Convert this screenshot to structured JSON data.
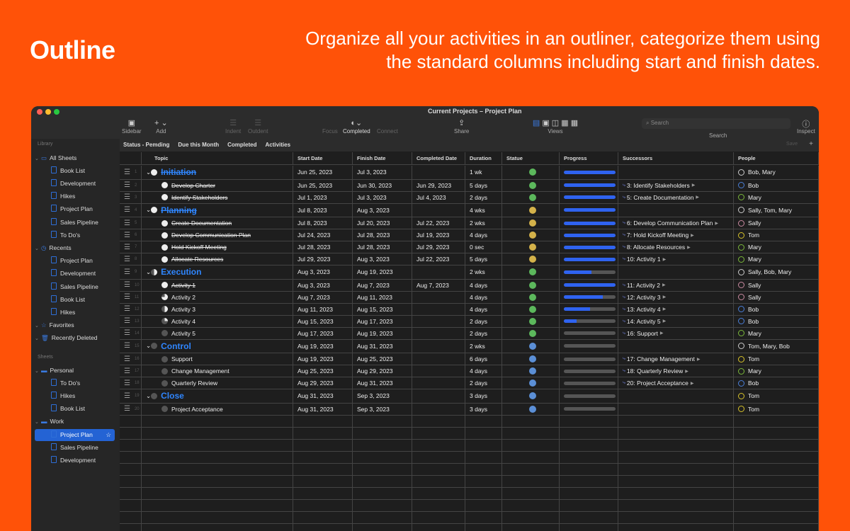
{
  "hero": {
    "title": "Outline",
    "text": "Organize all your activities in an outliner, categorize them using the standard columns including start and finish dates."
  },
  "window": {
    "title": "Current Projects – Project Plan"
  },
  "toolbar": {
    "sidebar": "Sidebar",
    "add": "Add",
    "indent": "Indent",
    "outdent": "Outdent",
    "focus": "Focus",
    "completed": "Completed",
    "connect": "Connect",
    "share": "Share",
    "views": "Views",
    "search_placeholder": "Search",
    "search": "Search",
    "inspect": "Inspect",
    "save": "Save"
  },
  "filters": [
    "Status - Pemding",
    "Due this Month",
    "Completed",
    "Activities"
  ],
  "sidebar": {
    "library": "Library",
    "sheets_label": "Sheets",
    "items": [
      {
        "label": "All Sheets",
        "type": "group",
        "icon": "tray-icon"
      },
      {
        "label": "Book List",
        "type": "child"
      },
      {
        "label": "Development",
        "type": "child"
      },
      {
        "label": "Hikes",
        "type": "child"
      },
      {
        "label": "Project Plan",
        "type": "child"
      },
      {
        "label": "Sales Pipeline",
        "type": "child"
      },
      {
        "label": "To Do's",
        "type": "child"
      },
      {
        "label": "Recents",
        "type": "group",
        "icon": "clock-icon"
      },
      {
        "label": "Project Plan",
        "type": "child"
      },
      {
        "label": "Development",
        "type": "child"
      },
      {
        "label": "Sales Pipeline",
        "type": "child"
      },
      {
        "label": "Book List",
        "type": "child"
      },
      {
        "label": "Hikes",
        "type": "child"
      },
      {
        "label": "Favorites",
        "type": "group",
        "icon": "star-icon"
      },
      {
        "label": "Recently Deleted",
        "type": "group",
        "icon": "trash-icon"
      }
    ],
    "sheets": [
      {
        "label": "Personal",
        "type": "group",
        "icon": "folder-icon"
      },
      {
        "label": "To Do's",
        "type": "child"
      },
      {
        "label": "Hikes",
        "type": "child"
      },
      {
        "label": "Book List",
        "type": "child"
      },
      {
        "label": "Work",
        "type": "group",
        "icon": "folder-icon"
      },
      {
        "label": "Project Plan",
        "type": "child",
        "selected": true
      },
      {
        "label": "Sales Pipeline",
        "type": "child"
      },
      {
        "label": "Development",
        "type": "child"
      }
    ]
  },
  "columns": [
    "Topic",
    "Start Date",
    "Finish Date",
    "Completed Date",
    "Duration",
    "Statue",
    "Progress",
    "Successors",
    "People"
  ],
  "status_colors": {
    "green": "#5cb85c",
    "yellow": "#d4b24a",
    "blue": "#5b8fd6"
  },
  "rows": [
    {
      "n": "1",
      "topic": "Initiation",
      "group": true,
      "done": true,
      "start": "Jun 25, 2023",
      "finish": "Jul 3, 2023",
      "completed": "",
      "duration": "1 wk",
      "status": "green",
      "progress": 100,
      "succ": "",
      "people": "Bob, Mary",
      "pc": "#ccc"
    },
    {
      "n": "2",
      "topic": "Develop Charter",
      "done": true,
      "start": "Jun 25, 2023",
      "finish": "Jun 30, 2023",
      "completed": "Jun 29, 2023",
      "duration": "5 days",
      "status": "green",
      "progress": 100,
      "succ": "3: Identify Stakeholders",
      "people": "Bob",
      "pc": "#4a7fd8"
    },
    {
      "n": "3",
      "topic": "Identify Stakeholders",
      "done": true,
      "start": "Jul 1, 2023",
      "finish": "Jul 3, 2023",
      "completed": "Jul 4, 2023",
      "duration": "2 days",
      "status": "green",
      "progress": 100,
      "succ": "5: Create Documentation",
      "people": "Mary",
      "pc": "#7ab83a"
    },
    {
      "n": "4",
      "topic": "Planning",
      "group": true,
      "done": true,
      "start": "Jul 8, 2023",
      "finish": "Aug 3, 2023",
      "completed": "",
      "duration": "4 wks",
      "status": "yellow",
      "progress": 100,
      "succ": "",
      "people": "Sally, Tom, Mary",
      "pc": "#ccc"
    },
    {
      "n": "5",
      "topic": "Create Documentation",
      "done": true,
      "start": "Jul 8, 2023",
      "finish": "Jul 20, 2023",
      "completed": "Jul 22, 2023",
      "duration": "2 wks",
      "status": "yellow",
      "progress": 100,
      "succ": "6: Develop Communication Plan",
      "people": "Sally",
      "pc": "#c98aa0"
    },
    {
      "n": "6",
      "topic": "Develop Communication Plan",
      "done": true,
      "start": "Jul 24, 2023",
      "finish": "Jul 28, 2023",
      "completed": "Jul 19, 2023",
      "duration": "4 days",
      "status": "yellow",
      "progress": 100,
      "succ": "7: Hold Kickoff Meeting",
      "people": "Tom",
      "pc": "#d6c22a"
    },
    {
      "n": "7",
      "topic": "Hold Kickoff Meeting",
      "done": true,
      "start": "Jul 28, 2023",
      "finish": "Jul 28, 2023",
      "completed": "Jul 29, 2023",
      "duration": "0 sec",
      "status": "yellow",
      "progress": 100,
      "succ": "8: Allocate Resources",
      "people": "Mary",
      "pc": "#7ab83a"
    },
    {
      "n": "8",
      "topic": "Allocate Resources",
      "done": true,
      "start": "Jul 29, 2023",
      "finish": "Aug 3, 2023",
      "completed": "Jul 22, 2023",
      "duration": "5 days",
      "status": "yellow",
      "progress": 100,
      "succ": "10: Activity 1",
      "people": "Mary",
      "pc": "#7ab83a"
    },
    {
      "n": "9",
      "topic": "Execution",
      "group": true,
      "start": "Aug 3, 2023",
      "finish": "Aug 19, 2023",
      "completed": "",
      "duration": "2 wks",
      "status": "green",
      "progress": 53,
      "succ": "",
      "people": "Sally, Bob, Mary",
      "pc": "#ccc"
    },
    {
      "n": "10",
      "topic": "Activity 1",
      "done": true,
      "start": "Aug 3, 2023",
      "finish": "Aug 7, 2023",
      "completed": "Aug 7, 2023",
      "duration": "4 days",
      "status": "green",
      "progress": 100,
      "succ": "11: Activity 2",
      "people": "Sally",
      "pc": "#c98aa0"
    },
    {
      "n": "11",
      "topic": "Activity 2",
      "start": "Aug 7, 2023",
      "finish": "Aug 11, 2023",
      "completed": "",
      "duration": "4 days",
      "status": "green",
      "progress": 75,
      "succ": "12: Activity 3",
      "people": "Sally",
      "pc": "#c98aa0"
    },
    {
      "n": "12",
      "topic": "Activity 3",
      "start": "Aug 11, 2023",
      "finish": "Aug 15, 2023",
      "completed": "",
      "duration": "4 days",
      "status": "green",
      "progress": 50,
      "succ": "13: Activity 4",
      "people": "Bob",
      "pc": "#4a7fd8"
    },
    {
      "n": "13",
      "topic": "Activity 4",
      "start": "Aug 15, 2023",
      "finish": "Aug 17, 2023",
      "completed": "",
      "duration": "2 days",
      "status": "green",
      "progress": 25,
      "succ": "14: Activity 5",
      "people": "Bob",
      "pc": "#4a7fd8"
    },
    {
      "n": "14",
      "topic": "Activity 5",
      "start": "Aug 17, 2023",
      "finish": "Aug 19, 2023",
      "completed": "",
      "duration": "2 days",
      "status": "green",
      "progress": 0,
      "succ": "16: Support",
      "people": "Mary",
      "pc": "#7ab83a"
    },
    {
      "n": "15",
      "topic": "Control",
      "group": true,
      "start": "Aug 19, 2023",
      "finish": "Aug 31, 2023",
      "completed": "",
      "duration": "2 wks",
      "status": "blue",
      "progress": 0,
      "succ": "",
      "people": "Tom, Mary, Bob",
      "pc": "#ccc"
    },
    {
      "n": "16",
      "topic": "Support",
      "start": "Aug 19, 2023",
      "finish": "Aug 25, 2023",
      "completed": "",
      "duration": "6 days",
      "status": "blue",
      "progress": 0,
      "succ": "17: Change Management",
      "people": "Tom",
      "pc": "#d6c22a"
    },
    {
      "n": "17",
      "topic": "Change Management",
      "start": "Aug 25, 2023",
      "finish": "Aug 29, 2023",
      "completed": "",
      "duration": "4 days",
      "status": "blue",
      "progress": 0,
      "succ": "18: Quarterly Review",
      "people": "Mary",
      "pc": "#7ab83a"
    },
    {
      "n": "18",
      "topic": "Quarterly Review",
      "start": "Aug 29, 2023",
      "finish": "Aug 31, 2023",
      "completed": "",
      "duration": "2 days",
      "status": "blue",
      "progress": 0,
      "succ": "20: Project Acceptance",
      "people": "Bob",
      "pc": "#4a7fd8"
    },
    {
      "n": "19",
      "topic": "Close",
      "group": true,
      "start": "Aug 31, 2023",
      "finish": "Sep 3, 2023",
      "completed": "",
      "duration": "3 days",
      "status": "blue",
      "progress": 0,
      "succ": "",
      "people": "Tom",
      "pc": "#d6c22a"
    },
    {
      "n": "20",
      "topic": "Project Acceptance",
      "start": "Aug 31, 2023",
      "finish": "Sep 3, 2023",
      "completed": "",
      "duration": "3 days",
      "status": "blue",
      "progress": 0,
      "succ": "",
      "people": "Tom",
      "pc": "#d6c22a"
    }
  ]
}
